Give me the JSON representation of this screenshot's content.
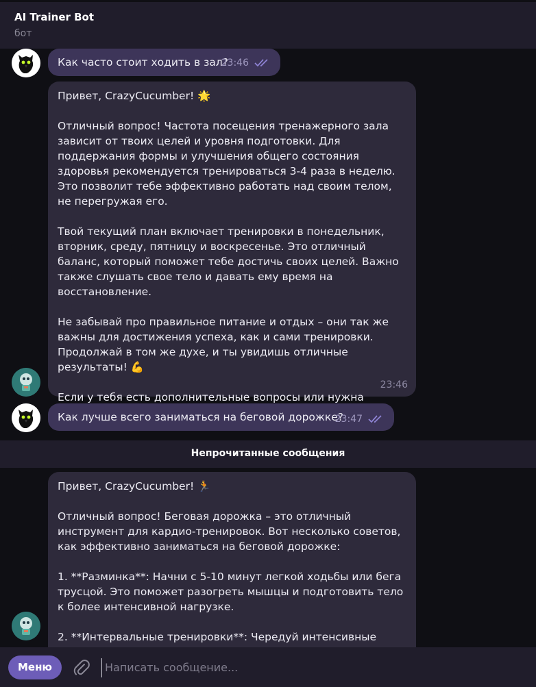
{
  "header": {
    "title": "AI Trainer Bot",
    "subtitle": "бот"
  },
  "messages": [
    {
      "from": "user",
      "text": "Как часто стоит ходить в зал?",
      "time": "23:46",
      "status_icon": "double-check-icon"
    },
    {
      "from": "bot",
      "text": "Привет, CrazyCucumber! 🌟\n\nОтличный вопрос! Частота посещения тренажерного зала зависит от твоих целей и уровня подготовки. Для поддержания формы и улучшения общего состояния здоровья рекомендуется тренироваться 3-4 раза в неделю. Это позволит тебе эффективно работать над своим телом, не перегружая его.\n\nТвой текущий план включает тренировки в понедельник, вторник, среду, пятницу и воскресенье. Это отличный баланс, который поможет тебе достичь своих целей. Важно также слушать свое тело и давать ему время на восстановление.\n\nНе забывай про правильное питание и отдых – они так же важны для достижения успеха, как и сами тренировки. Продолжай в том же духе, и ты увидишь отличные результаты! 💪\n\nЕсли у тебя есть дополнительные вопросы или нужна помощь, всегда готов поддержать тебя на этом пути!",
      "time": "23:46"
    },
    {
      "from": "user",
      "text": "Как лучше всего заниматься на беговой дорожке?",
      "time": "23:47",
      "status_icon": "double-check-icon"
    },
    {
      "from": "bot",
      "text": "Привет, CrazyCucumber! 🏃\n\nОтличный вопрос! Беговая дорожка – это отличный инструмент для кардио-тренировок. Вот несколько советов, как эффективно заниматься на беговой дорожке:\n\n1. **Разминка**: Начни с 5-10 минут легкой ходьбы или бега трусцой. Это поможет разогреть мышцы и подготовить тело к более интенсивной нагрузке.\n\n2. **Интервальные тренировки**: Чередуй интенсивные"
    }
  ],
  "unread_divider": "Непрочитанные сообщения",
  "composer": {
    "menu_label": "Меню",
    "placeholder": "Написать сообщение...",
    "attach_icon": "paperclip-icon"
  },
  "colors": {
    "accent": "#6d5db8",
    "panel": "#201d2b",
    "background": "#0f0f14",
    "bot_bubble": "#2e2a3b",
    "user_bubble": "#3d3559"
  }
}
